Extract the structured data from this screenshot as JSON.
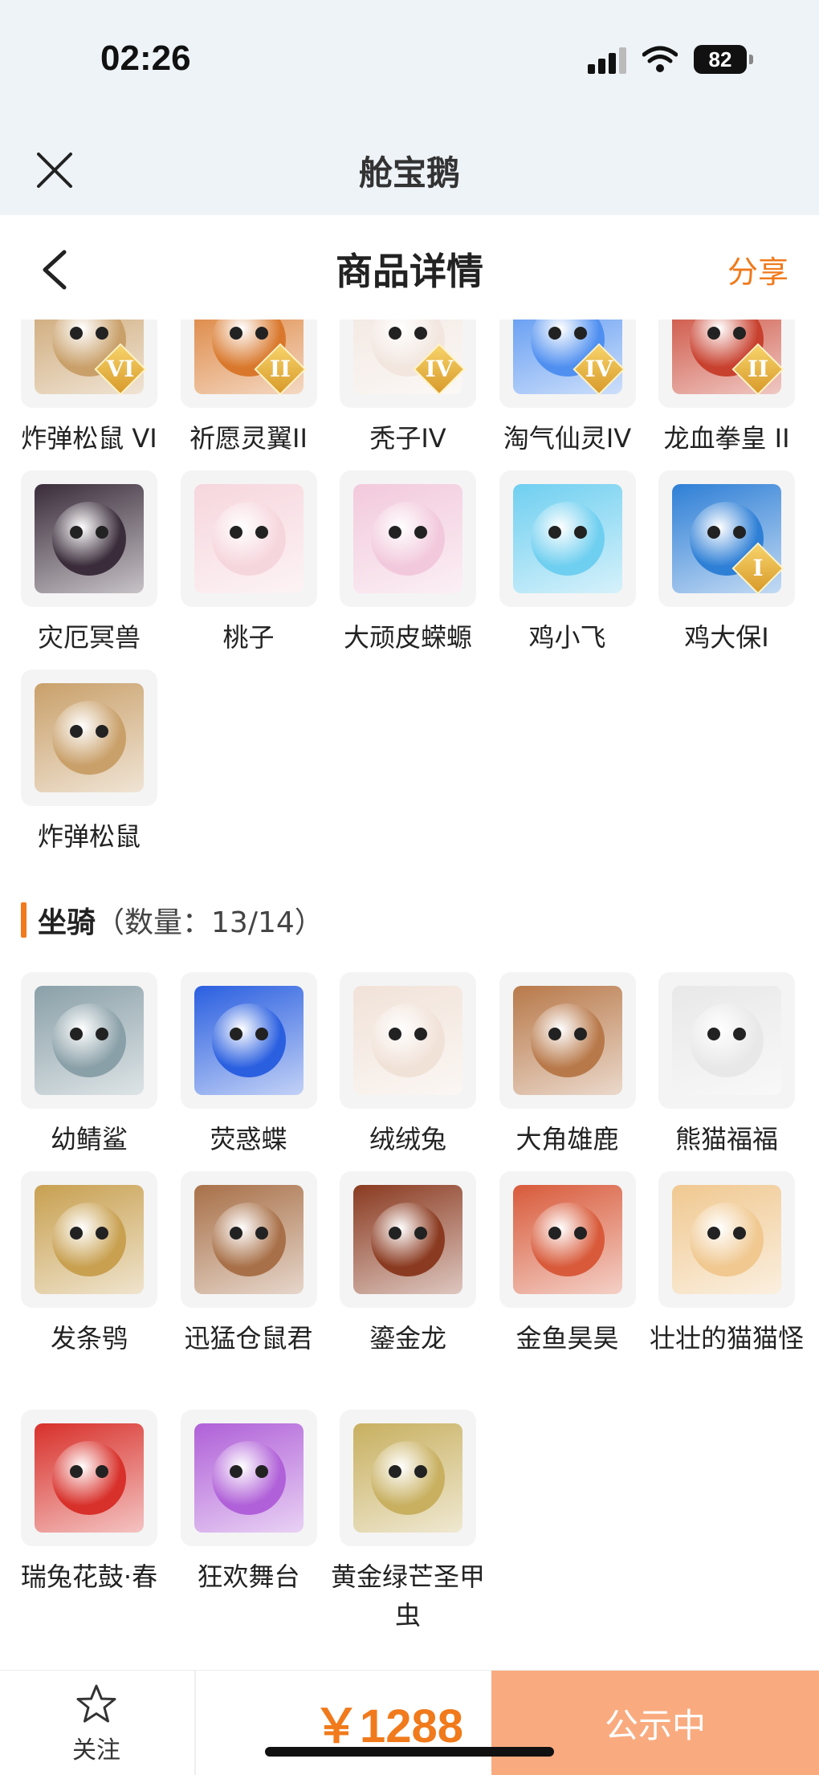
{
  "status_bar": {
    "time": "02:26",
    "battery": "82"
  },
  "mini_app": {
    "title": "舱宝鹅"
  },
  "nav": {
    "title": "商品详情",
    "share": "分享"
  },
  "skins": [
    {
      "name": "炸弹松鼠 VI",
      "rank": "VI",
      "color": "#c9a06a"
    },
    {
      "name": "祈愿灵翼II",
      "rank": "II",
      "color": "#d9782c"
    },
    {
      "name": "秃子IV",
      "rank": "IV",
      "color": "#f2e6df"
    },
    {
      "name": "淘气仙灵IV",
      "rank": "IV",
      "color": "#4f8ff0"
    },
    {
      "name": "龙血拳皇 II",
      "rank": "II",
      "color": "#c8402e"
    },
    {
      "name": "灾厄冥兽",
      "rank": "",
      "color": "#3a2c3a"
    },
    {
      "name": "桃子",
      "rank": "",
      "color": "#f6d6dd"
    },
    {
      "name": "大顽皮蝾螈",
      "rank": "",
      "color": "#f2c9dc"
    },
    {
      "name": "鸡小飞",
      "rank": "",
      "color": "#6fcff0"
    },
    {
      "name": "鸡大保I",
      "rank": "I",
      "color": "#2e7fd6"
    },
    {
      "name": "炸弹松鼠",
      "rank": "",
      "color": "#c9a06a"
    }
  ],
  "mounts_section": {
    "name": "坐骑",
    "count": "（数量：13/14）"
  },
  "mounts": [
    {
      "name": "幼鲭鲨",
      "color": "#8aa0a8"
    },
    {
      "name": "荧惑蝶",
      "color": "#2a5fe0"
    },
    {
      "name": "绒绒兔",
      "color": "#f1e2d8"
    },
    {
      "name": "大角雄鹿",
      "color": "#b8794a"
    },
    {
      "name": "熊猫福福",
      "color": "#e8e8e8"
    },
    {
      "name": "发条鸮",
      "color": "#c8a050"
    },
    {
      "name": "迅猛仓鼠君",
      "color": "#a87048"
    },
    {
      "name": "鎏金龙",
      "color": "#8a3a20"
    },
    {
      "name": "金鱼昊昊",
      "color": "#d85a3a"
    },
    {
      "name": "壮壮的猫猫怪",
      "color": "#f0c890"
    },
    {
      "name": "瑞兔花鼓·春",
      "color": "#d8302a"
    },
    {
      "name": "狂欢舞台",
      "color": "#b060d8"
    },
    {
      "name": "黄金绿芒圣甲虫",
      "color": "#c8b060"
    }
  ],
  "bottom": {
    "follow": "关注",
    "price": "￥1288",
    "status": "公示中"
  }
}
